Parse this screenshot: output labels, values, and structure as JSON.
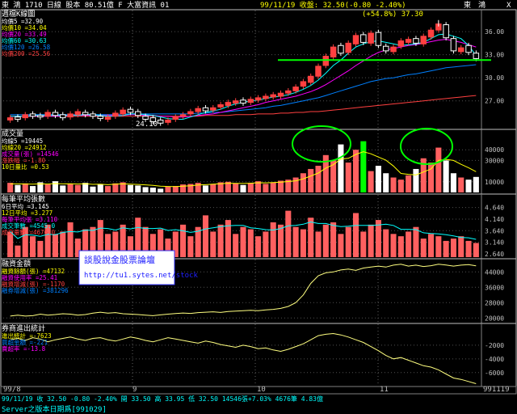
{
  "header": {
    "left": "東  鴻 1710  日線 股本 80.51億 F  大富資訊   01",
    "center": "99/11/19 收盤: 32.50(-0.80 -2.40%)",
    "right_a": "東",
    "right_b": "鴻",
    "close_button": "X"
  },
  "panels": {
    "kline": {
      "title": "週檔K線圖",
      "legend": [
        {
          "text": "均價5 =32.90",
          "color": "#ffffff"
        },
        {
          "text": "均價10 =34.04",
          "color": "#ffff00"
        },
        {
          "text": "均價20 =33.49",
          "color": "#ff00ff"
        },
        {
          "text": "均價60 =30.63",
          "color": "#00ffff"
        },
        {
          "text": "均價120 =26.58",
          "color": "#0080ff"
        },
        {
          "text": "均價200 =25.56",
          "color": "#ff4040"
        }
      ],
      "annotation_high": "(+54.8%) 37.30",
      "annotation_low": "24.10",
      "axis": [
        "36.00",
        "33.00",
        "30.00",
        "27.00"
      ]
    },
    "volume": {
      "title": "成交量",
      "legend": [
        {
          "text": "均線5 =19445",
          "color": "#ffffff"
        },
        {
          "text": "均線20 =24912",
          "color": "#ffff00"
        },
        {
          "text": "成交量(張) =14546",
          "color": "#ff00ff"
        },
        {
          "text": "漲跌幅 =-1.80",
          "color": "#ff4040"
        },
        {
          "text": "10日量比 =0.53",
          "color": "#ffff00"
        }
      ],
      "axis": [
        "40000",
        "30000",
        "10000"
      ]
    },
    "avg": {
      "title": "每筆平均張數",
      "legend": [
        {
          "text": "6日平均 =3.145",
          "color": "#ffffff"
        },
        {
          "text": "12日平均 =3.277",
          "color": "#ffff00"
        },
        {
          "text": "每筆平均張 =3.110",
          "color": "#ff00ff"
        },
        {
          "text": "成交筆數 =4545.0",
          "color": "#00ffff"
        },
        {
          "text": "成交量數 =4676.0",
          "color": "#ff4040"
        }
      ],
      "axis": [
        "4.640",
        "4.140",
        "3.640",
        "3.140",
        "2.640"
      ]
    },
    "margin": {
      "title": "融資金額",
      "legend": [
        {
          "text": "融資餘額(張) =47132",
          "color": "#ffff00"
        },
        {
          "text": "融資使用率 =25.41",
          "color": "#ff00ff"
        },
        {
          "text": "融資增減(張) =-1170",
          "color": "#ff4040"
        },
        {
          "text": "融券增減(張) =381296",
          "color": "#0080ff"
        }
      ],
      "axis": [
        "44000",
        "36000",
        "28000",
        "20000"
      ],
      "watermark_title": "談股說金股票論壇",
      "watermark_url": "http://tu1.sytes.net/stock"
    },
    "broker": {
      "title": "券商進出統計",
      "legend": [
        {
          "text": "進出統計 =-7623",
          "color": "#ffff00"
        },
        {
          "text": "買超金額 =-221",
          "color": "#0080ff"
        },
        {
          "text": "賣超率 =-13.8",
          "color": "#ff00ff"
        }
      ],
      "axis": [
        "-2000",
        "-4000",
        "-6000"
      ]
    }
  },
  "xaxis": {
    "labels": [
      "99/8",
      "9",
      "10",
      "11"
    ],
    "end_label": "991119"
  },
  "footer": {
    "status": "99/11/19  收 32.50  -0.80  -2.40%  開 33.50  高 33.95  低 32.50  14546張+7.03%  4676筆  4.83億",
    "bottom": "Server之版本日期爲[991029]"
  },
  "chart_data": [
    {
      "type": "candlestick",
      "title": "週檔K線圖",
      "series_close": [
        24.8,
        24.6,
        25.2,
        25.0,
        24.9,
        25.5,
        25.1,
        24.8,
        25.3,
        25.6,
        25.2,
        25.0,
        24.7,
        24.9,
        25.4,
        25.8,
        25.5,
        25.1,
        24.6,
        24.3,
        24.1,
        24.5,
        24.9,
        25.2,
        25.6,
        26.0,
        25.7,
        26.1,
        26.5,
        26.8,
        27.0,
        26.7,
        27.2,
        27.4,
        27.6,
        27.8,
        28.0,
        28.3,
        28.8,
        29.5,
        30.2,
        31.5,
        32.8,
        34.0,
        33.2,
        34.5,
        35.5,
        34.6,
        35.8,
        34.2,
        33.5,
        34.0,
        34.8,
        35.0,
        34.5,
        35.4,
        36.2,
        37.0,
        35.2,
        33.5,
        33.9,
        33.3,
        32.5
      ],
      "series_open": [
        24.5,
        24.9,
        24.8,
        25.3,
        25.1,
        25.0,
        25.5,
        25.2,
        24.9,
        25.2,
        25.5,
        25.3,
        25.0,
        24.6,
        25.0,
        25.3,
        25.9,
        25.6,
        25.0,
        24.8,
        24.5,
        24.2,
        24.6,
        25.0,
        25.3,
        25.6,
        26.1,
        25.8,
        26.2,
        26.4,
        26.7,
        27.1,
        26.8,
        27.1,
        27.3,
        27.5,
        27.6,
        28.0,
        28.3,
        28.9,
        29.4,
        30.2,
        31.6,
        32.7,
        34.2,
        33.3,
        34.4,
        35.6,
        34.5,
        35.9,
        34.1,
        33.4,
        34.1,
        34.6,
        35.1,
        34.4,
        35.3,
        36.2,
        36.9,
        35.1,
        33.4,
        34.2,
        33.2
      ],
      "shown_high": 37.3,
      "shown_low": 24.1,
      "support_line": 32.3,
      "ma_short": [
        25.0,
        25.0,
        25.0,
        25.1,
        25.1,
        25.1,
        25.1,
        25.1,
        25.1,
        25.1,
        25.2,
        25.2,
        25.1,
        25.0,
        25.0,
        25.1,
        25.3,
        25.3,
        25.2,
        25.1,
        24.9,
        24.7,
        24.6,
        24.6,
        24.9,
        25.2,
        25.5,
        25.7,
        25.9,
        26.3,
        26.6,
        26.8,
        27.0,
        27.1,
        27.3,
        27.5,
        27.6,
        27.8,
        28.1,
        28.5,
        29.0,
        29.7,
        30.6,
        31.6,
        32.3,
        33.2,
        34.0,
        34.4,
        34.7,
        34.8,
        34.6,
        34.4,
        34.2,
        34.3,
        34.4,
        34.6,
        35.1,
        35.6,
        35.7,
        35.4,
        35.1,
        34.2,
        32.9
      ],
      "ma_mid": [
        25.0,
        25.0,
        25.0,
        25.0,
        25.0,
        25.0,
        25.0,
        25.0,
        25.1,
        25.1,
        25.1,
        25.1,
        25.1,
        25.1,
        25.1,
        25.1,
        25.2,
        25.2,
        25.1,
        25.1,
        25.0,
        25.0,
        24.9,
        24.9,
        25.0,
        25.1,
        25.2,
        25.3,
        25.5,
        25.7,
        25.9,
        26.1,
        26.3,
        26.5,
        26.8,
        27.0,
        27.2,
        27.4,
        27.6,
        27.9,
        28.2,
        28.6,
        29.1,
        29.7,
        30.3,
        30.9,
        31.6,
        32.2,
        32.8,
        33.3,
        33.6,
        33.8,
        34.0,
        34.2,
        34.3,
        34.5,
        34.7,
        34.9,
        35.0,
        34.8,
        34.6,
        34.3,
        34.0
      ],
      "ma_long": [
        25.2,
        25.2,
        25.2,
        25.2,
        25.2,
        25.2,
        25.2,
        25.2,
        25.2,
        25.2,
        25.2,
        25.2,
        25.2,
        25.2,
        25.2,
        25.3,
        25.3,
        25.3,
        25.3,
        25.3,
        25.3,
        25.3,
        25.3,
        25.3,
        25.3,
        25.4,
        25.4,
        25.5,
        25.5,
        25.6,
        25.7,
        25.8,
        25.9,
        26.0,
        26.1,
        26.3,
        26.4,
        26.6,
        26.8,
        27.0,
        27.2,
        27.4,
        27.7,
        28.0,
        28.3,
        28.6,
        28.9,
        29.2,
        29.5,
        29.7,
        29.9,
        30.0,
        30.2,
        30.4,
        30.5,
        30.7,
        30.9,
        31.1,
        31.3,
        31.4,
        31.5,
        31.6,
        31.7
      ],
      "ma_vlong": [
        25.0,
        25.0,
        25.0,
        25.0,
        25.0,
        25.0,
        25.0,
        25.0,
        25.0,
        25.0,
        25.0,
        25.0,
        25.0,
        25.0,
        25.0,
        25.0,
        25.0,
        25.0,
        25.0,
        25.0,
        25.0,
        25.0,
        25.0,
        25.0,
        25.0,
        25.0,
        25.1,
        25.1,
        25.1,
        25.1,
        25.2,
        25.2,
        25.2,
        25.3,
        25.3,
        25.3,
        25.4,
        25.4,
        25.5,
        25.5,
        25.6,
        25.6,
        25.7,
        25.8,
        25.9,
        26.0,
        26.1,
        26.2,
        26.3,
        26.4,
        26.5,
        26.6,
        26.7,
        26.8,
        26.9,
        27.0,
        27.1,
        27.2,
        27.3,
        27.4,
        27.5,
        27.6,
        27.7
      ],
      "ylim": [
        23.5,
        37.8
      ]
    },
    {
      "type": "bar",
      "title": "成交量",
      "values": [
        9000,
        7000,
        8500,
        6000,
        9500,
        7500,
        10500,
        6500,
        8000,
        7000,
        9000,
        5500,
        7500,
        6000,
        8500,
        9500,
        7000,
        6500,
        5000,
        4500,
        3500,
        5500,
        6000,
        7500,
        8000,
        9000,
        6500,
        8000,
        9500,
        10000,
        8500,
        7000,
        9000,
        10500,
        8000,
        9500,
        11000,
        12000,
        14000,
        18000,
        22000,
        25000,
        35000,
        30000,
        45000,
        28000,
        40000,
        48000,
        20000,
        25000,
        18000,
        14000,
        12000,
        16000,
        22000,
        32000,
        28000,
        42000,
        30000,
        18000,
        14000,
        12000,
        14546
      ],
      "ma": [
        8000,
        8000,
        7900,
        7800,
        8000,
        7900,
        8300,
        8000,
        8100,
        7900,
        8200,
        7600,
        7700,
        7300,
        7700,
        8000,
        7700,
        7500,
        7100,
        6600,
        5800,
        5600,
        5500,
        5800,
        6200,
        7000,
        7300,
        7700,
        8200,
        8600,
        8500,
        8400,
        8600,
        9100,
        9000,
        9300,
        9600,
        10200,
        10900,
        12700,
        15400,
        18200,
        22800,
        26000,
        31400,
        32000,
        35600,
        38200,
        36200,
        33200,
        30200,
        24800,
        17800,
        17000,
        16400,
        19200,
        22000,
        30000,
        31000,
        30000,
        26400,
        23200,
        19445
      ],
      "ylim": [
        0,
        50000
      ]
    },
    {
      "type": "bar",
      "title": "每筆平均張數",
      "values": [
        3.6,
        3.0,
        3.8,
        3.4,
        3.2,
        3.9,
        3.5,
        3.6,
        4.0,
        3.3,
        3.7,
        3.8,
        4.1,
        3.5,
        3.6,
        3.9,
        3.4,
        4.2,
        3.8,
        3.5,
        3.7,
        3.3,
        3.6,
        3.9,
        3.4,
        3.8,
        4.3,
        3.6,
        3.9,
        4.1,
        3.5,
        3.8,
        3.7,
        3.4,
        3.6,
        4.0,
        3.9,
        4.5,
        3.8,
        3.7,
        4.2,
        3.6,
        3.9,
        4.0,
        3.5,
        3.8,
        4.4,
        3.6,
        3.9,
        4.1,
        3.7,
        3.5,
        3.4,
        3.6,
        3.8,
        3.3,
        3.5,
        3.4,
        3.2,
        3.3,
        3.4,
        3.2,
        3.11
      ],
      "ylim": [
        2.5,
        4.8
      ]
    },
    {
      "type": "line",
      "title": "融資金額",
      "values": [
        21000,
        21500,
        21000,
        21200,
        22000,
        21500,
        21800,
        22200,
        22000,
        21500,
        21800,
        22500,
        23000,
        22500,
        22800,
        22200,
        22000,
        21800,
        21500,
        21200,
        21600,
        22000,
        22300,
        22600,
        22400,
        22800,
        23000,
        23200,
        22900,
        23400,
        23600,
        23800,
        24000,
        23800,
        24200,
        24500,
        25000,
        26000,
        28000,
        32000,
        38000,
        42000,
        43500,
        44000,
        45000,
        45500,
        44800,
        46000,
        46500,
        47000,
        46500,
        47500,
        48000,
        47000,
        47500,
        46800,
        47200,
        48000,
        47600,
        47000,
        47500,
        47800,
        47132
      ],
      "ylim": [
        18000,
        50000
      ]
    },
    {
      "type": "line",
      "title": "券商進出統計",
      "values": [
        -1200,
        -1000,
        -1300,
        -900,
        -1100,
        -1500,
        -1200,
        -1000,
        -800,
        -1100,
        -1300,
        -1000,
        -900,
        -1200,
        -1400,
        -1100,
        -800,
        -1000,
        -1300,
        -1500,
        -1200,
        -900,
        -1100,
        -1300,
        -1500,
        -1700,
        -1400,
        -1600,
        -1900,
        -2100,
        -2300,
        -2000,
        -2200,
        -2500,
        -2400,
        -2700,
        -2900,
        -2600,
        -2200,
        -1800,
        -1200,
        -600,
        -400,
        -300,
        -500,
        -800,
        -1200,
        -1600,
        -2200,
        -2800,
        -3500,
        -4000,
        -3800,
        -4200,
        -4600,
        -5000,
        -5200,
        -5600,
        -6200,
        -6800,
        -7000,
        -7300,
        -7623
      ],
      "ylim": [
        -7800,
        0
      ]
    }
  ]
}
